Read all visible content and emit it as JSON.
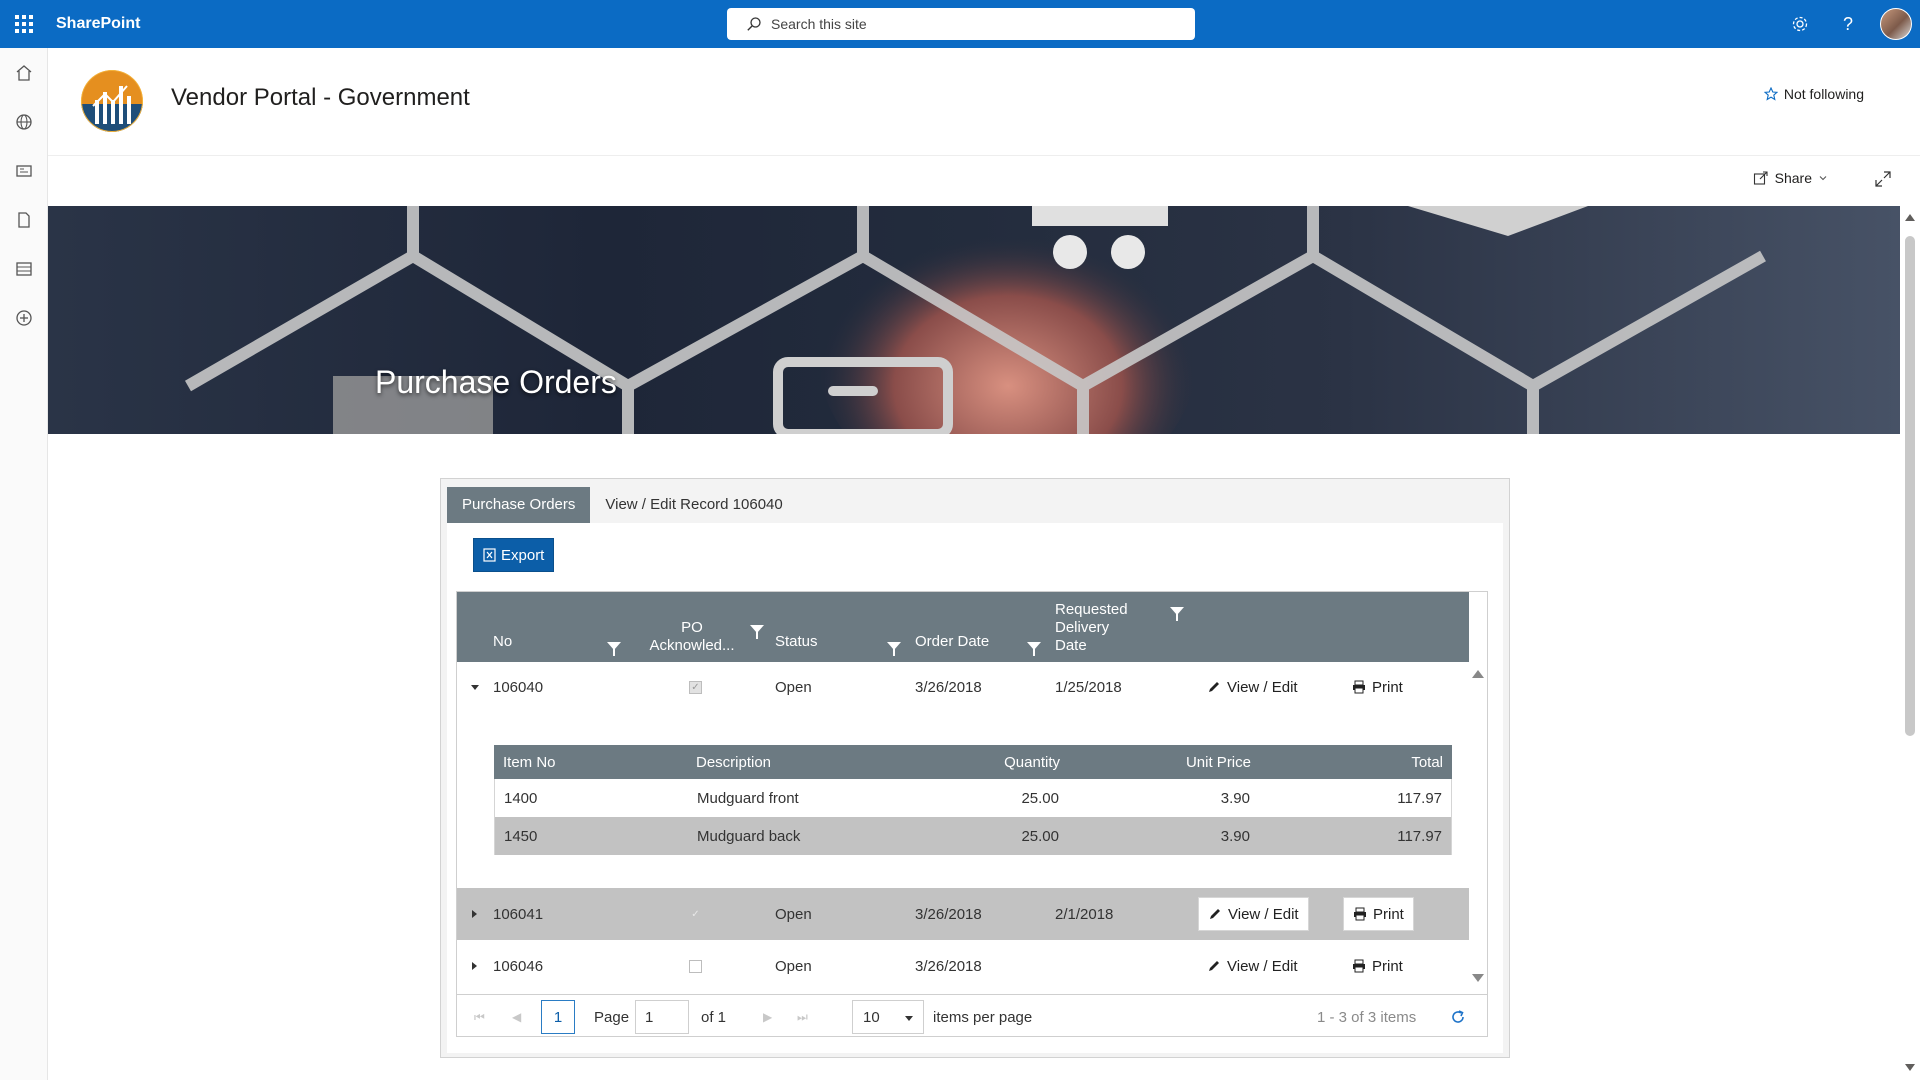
{
  "suite": {
    "brand": "SharePoint",
    "search_placeholder": "Search this site"
  },
  "site": {
    "title": "Vendor Portal - Government",
    "follow_label": "Not following",
    "share_label": "Share"
  },
  "banner": {
    "title": "Purchase Orders"
  },
  "tabs": [
    {
      "label": "Purchase Orders",
      "active": true
    },
    {
      "label": "View / Edit Record 106040",
      "active": false
    }
  ],
  "toolbar": {
    "export_label": "Export"
  },
  "grid": {
    "columns": {
      "no": "No",
      "po_ack": "PO Acknowled...",
      "po_ack_line1": "PO",
      "po_ack_line2": "Acknowled...",
      "status": "Status",
      "order_date": "Order Date",
      "req_line1": "Requested",
      "req_line2": "Delivery",
      "req_line3": "Date"
    },
    "rows": [
      {
        "no": "106040",
        "ack": true,
        "status": "Open",
        "order_date": "3/26/2018",
        "req_date": "1/25/2018",
        "expanded": true,
        "view_label": "View / Edit",
        "print_label": "Print"
      },
      {
        "no": "106041",
        "ack": true,
        "status": "Open",
        "order_date": "3/26/2018",
        "req_date": "2/1/2018",
        "expanded": false,
        "view_label": "View / Edit",
        "print_label": "Print"
      },
      {
        "no": "106046",
        "ack": false,
        "status": "Open",
        "order_date": "3/26/2018",
        "req_date": "",
        "expanded": false,
        "view_label": "View / Edit",
        "print_label": "Print"
      }
    ],
    "detail": {
      "columns": {
        "item_no": "Item No",
        "description": "Description",
        "quantity": "Quantity",
        "unit_price": "Unit Price",
        "total": "Total"
      },
      "rows": [
        {
          "item_no": "1400",
          "description": "Mudguard front",
          "quantity": "25.00",
          "unit_price": "3.90",
          "total": "117.97"
        },
        {
          "item_no": "1450",
          "description": "Mudguard back",
          "quantity": "25.00",
          "unit_price": "3.90",
          "total": "117.97"
        }
      ]
    }
  },
  "pager": {
    "current_page": "1",
    "page_label": "Page",
    "page_input": "1",
    "of_label": "of 1",
    "page_size": "10",
    "per_page_label": "items per page",
    "info": "1 - 3 of 3 items"
  },
  "colors": {
    "suite_bar": "#0b6bc4",
    "grid_header": "#6c7a82",
    "export_button": "#0c5ea8",
    "alt_row": "#c2c2c2"
  }
}
